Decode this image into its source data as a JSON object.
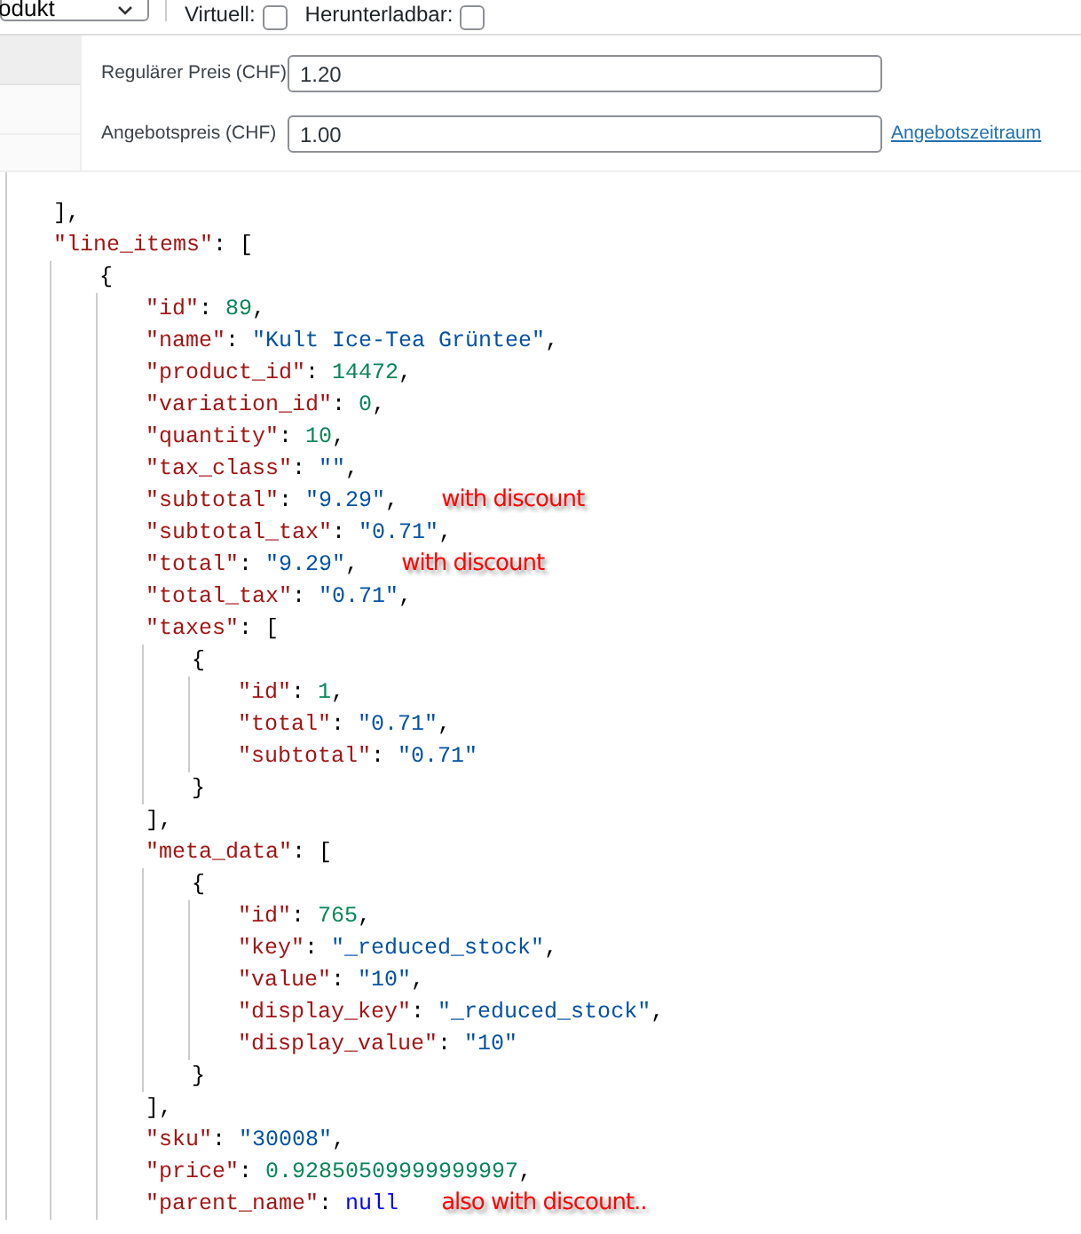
{
  "top_bar": {
    "product_type": "odukt",
    "options": [
      {
        "label": "Virtuell:",
        "checked": false
      },
      {
        "label": "Herunterladbar:",
        "checked": false
      }
    ]
  },
  "price_fields": [
    {
      "label": "Regulärer Preis (CHF)",
      "value": "1.20"
    },
    {
      "label": "Angebotspreis (CHF)",
      "value": "1.00",
      "link": "Angebotszeitraum"
    }
  ],
  "code": [
    {
      "tokens": [
        {
          "kind": "punct",
          "text": "],"
        }
      ]
    },
    {
      "tokens": [
        {
          "kind": "key",
          "text": "\"line_items\""
        },
        {
          "kind": "punct",
          "text": ": ["
        }
      ],
      "children": [
        {
          "tokens": [
            {
              "kind": "punct",
              "text": "{"
            }
          ],
          "children": [
            {
              "tokens": [
                {
                  "kind": "key",
                  "text": "\"id\""
                },
                {
                  "kind": "punct",
                  "text": ": "
                },
                {
                  "kind": "number",
                  "text": "89"
                },
                {
                  "kind": "punct",
                  "text": ","
                }
              ]
            },
            {
              "tokens": [
                {
                  "kind": "key",
                  "text": "\"name\""
                },
                {
                  "kind": "punct",
                  "text": ": "
                },
                {
                  "kind": "string",
                  "text": "\"Kult Ice-Tea Grüntee\""
                },
                {
                  "kind": "punct",
                  "text": ","
                }
              ]
            },
            {
              "tokens": [
                {
                  "kind": "key",
                  "text": "\"product_id\""
                },
                {
                  "kind": "punct",
                  "text": ": "
                },
                {
                  "kind": "number",
                  "text": "14472"
                },
                {
                  "kind": "punct",
                  "text": ","
                }
              ]
            },
            {
              "tokens": [
                {
                  "kind": "key",
                  "text": "\"variation_id\""
                },
                {
                  "kind": "punct",
                  "text": ": "
                },
                {
                  "kind": "number",
                  "text": "0"
                },
                {
                  "kind": "punct",
                  "text": ","
                }
              ]
            },
            {
              "tokens": [
                {
                  "kind": "key",
                  "text": "\"quantity\""
                },
                {
                  "kind": "punct",
                  "text": ": "
                },
                {
                  "kind": "number",
                  "text": "10"
                },
                {
                  "kind": "punct",
                  "text": ","
                }
              ]
            },
            {
              "tokens": [
                {
                  "kind": "key",
                  "text": "\"tax_class\""
                },
                {
                  "kind": "punct",
                  "text": ": "
                },
                {
                  "kind": "string",
                  "text": "\"\""
                },
                {
                  "kind": "punct",
                  "text": ","
                }
              ]
            },
            {
              "tokens": [
                {
                  "kind": "key",
                  "text": "\"subtotal\""
                },
                {
                  "kind": "punct",
                  "text": ": "
                },
                {
                  "kind": "string",
                  "text": "\"9.29\""
                },
                {
                  "kind": "punct",
                  "text": ","
                }
              ],
              "note": "with discount"
            },
            {
              "tokens": [
                {
                  "kind": "key",
                  "text": "\"subtotal_tax\""
                },
                {
                  "kind": "punct",
                  "text": ": "
                },
                {
                  "kind": "string",
                  "text": "\"0.71\""
                },
                {
                  "kind": "punct",
                  "text": ","
                }
              ]
            },
            {
              "tokens": [
                {
                  "kind": "key",
                  "text": "\"total\""
                },
                {
                  "kind": "punct",
                  "text": ": "
                },
                {
                  "kind": "string",
                  "text": "\"9.29\""
                },
                {
                  "kind": "punct",
                  "text": ","
                }
              ],
              "note": "with discount"
            },
            {
              "tokens": [
                {
                  "kind": "key",
                  "text": "\"total_tax\""
                },
                {
                  "kind": "punct",
                  "text": ": "
                },
                {
                  "kind": "string",
                  "text": "\"0.71\""
                },
                {
                  "kind": "punct",
                  "text": ","
                }
              ]
            },
            {
              "tokens": [
                {
                  "kind": "key",
                  "text": "\"taxes\""
                },
                {
                  "kind": "punct",
                  "text": ": ["
                }
              ],
              "children": [
                {
                  "tokens": [
                    {
                      "kind": "punct",
                      "text": "{"
                    }
                  ],
                  "children": [
                    {
                      "tokens": [
                        {
                          "kind": "key",
                          "text": "\"id\""
                        },
                        {
                          "kind": "punct",
                          "text": ": "
                        },
                        {
                          "kind": "number",
                          "text": "1"
                        },
                        {
                          "kind": "punct",
                          "text": ","
                        }
                      ]
                    },
                    {
                      "tokens": [
                        {
                          "kind": "key",
                          "text": "\"total\""
                        },
                        {
                          "kind": "punct",
                          "text": ": "
                        },
                        {
                          "kind": "string",
                          "text": "\"0.71\""
                        },
                        {
                          "kind": "punct",
                          "text": ","
                        }
                      ]
                    },
                    {
                      "tokens": [
                        {
                          "kind": "key",
                          "text": "\"subtotal\""
                        },
                        {
                          "kind": "punct",
                          "text": ": "
                        },
                        {
                          "kind": "string",
                          "text": "\"0.71\""
                        }
                      ]
                    }
                  ]
                },
                {
                  "tokens": [
                    {
                      "kind": "punct",
                      "text": "}"
                    }
                  ]
                }
              ]
            },
            {
              "tokens": [
                {
                  "kind": "punct",
                  "text": "],"
                }
              ]
            },
            {
              "tokens": [
                {
                  "kind": "key",
                  "text": "\"meta_data\""
                },
                {
                  "kind": "punct",
                  "text": ": ["
                }
              ],
              "children": [
                {
                  "tokens": [
                    {
                      "kind": "punct",
                      "text": "{"
                    }
                  ],
                  "children": [
                    {
                      "tokens": [
                        {
                          "kind": "key",
                          "text": "\"id\""
                        },
                        {
                          "kind": "punct",
                          "text": ": "
                        },
                        {
                          "kind": "number",
                          "text": "765"
                        },
                        {
                          "kind": "punct",
                          "text": ","
                        }
                      ]
                    },
                    {
                      "tokens": [
                        {
                          "kind": "key",
                          "text": "\"key\""
                        },
                        {
                          "kind": "punct",
                          "text": ": "
                        },
                        {
                          "kind": "string",
                          "text": "\"_reduced_stock\""
                        },
                        {
                          "kind": "punct",
                          "text": ","
                        }
                      ]
                    },
                    {
                      "tokens": [
                        {
                          "kind": "key",
                          "text": "\"value\""
                        },
                        {
                          "kind": "punct",
                          "text": ": "
                        },
                        {
                          "kind": "string",
                          "text": "\"10\""
                        },
                        {
                          "kind": "punct",
                          "text": ","
                        }
                      ]
                    },
                    {
                      "tokens": [
                        {
                          "kind": "key",
                          "text": "\"display_key\""
                        },
                        {
                          "kind": "punct",
                          "text": ": "
                        },
                        {
                          "kind": "string",
                          "text": "\"_reduced_stock\""
                        },
                        {
                          "kind": "punct",
                          "text": ","
                        }
                      ]
                    },
                    {
                      "tokens": [
                        {
                          "kind": "key",
                          "text": "\"display_value\""
                        },
                        {
                          "kind": "punct",
                          "text": ": "
                        },
                        {
                          "kind": "string",
                          "text": "\"10\""
                        }
                      ]
                    }
                  ]
                },
                {
                  "tokens": [
                    {
                      "kind": "punct",
                      "text": "}"
                    }
                  ]
                }
              ]
            },
            {
              "tokens": [
                {
                  "kind": "punct",
                  "text": "],"
                }
              ]
            },
            {
              "tokens": [
                {
                  "kind": "key",
                  "text": "\"sku\""
                },
                {
                  "kind": "punct",
                  "text": ": "
                },
                {
                  "kind": "string",
                  "text": "\"30008\""
                },
                {
                  "kind": "punct",
                  "text": ","
                }
              ]
            },
            {
              "tokens": [
                {
                  "kind": "key",
                  "text": "\"price\""
                },
                {
                  "kind": "punct",
                  "text": ": "
                },
                {
                  "kind": "number",
                  "text": "0.92850509999999997"
                },
                {
                  "kind": "punct",
                  "text": ","
                }
              ]
            },
            {
              "tokens": [
                {
                  "kind": "key",
                  "text": "\"parent_name\""
                },
                {
                  "kind": "punct",
                  "text": ": "
                },
                {
                  "kind": "null",
                  "text": "null"
                }
              ],
              "note": "also with discount.."
            }
          ]
        }
      ]
    }
  ]
}
